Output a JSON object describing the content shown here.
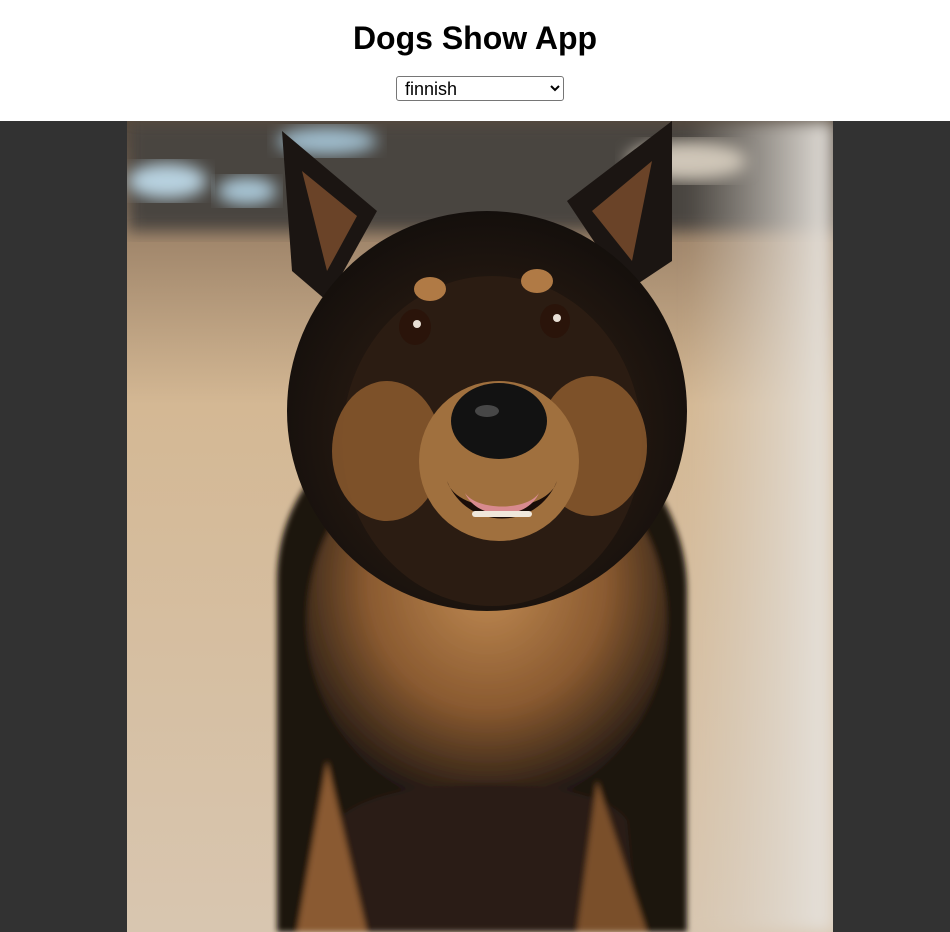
{
  "app": {
    "title": "Dogs Show App"
  },
  "breed_select": {
    "selected": "finnish",
    "options": [
      "finnish"
    ]
  },
  "photo": {
    "subject": "dog-photo",
    "colors": {
      "stage_background": "#323232",
      "fur_dark": "#1a1410",
      "fur_tan": "#b07a45",
      "floor": "#cdb89e"
    }
  }
}
